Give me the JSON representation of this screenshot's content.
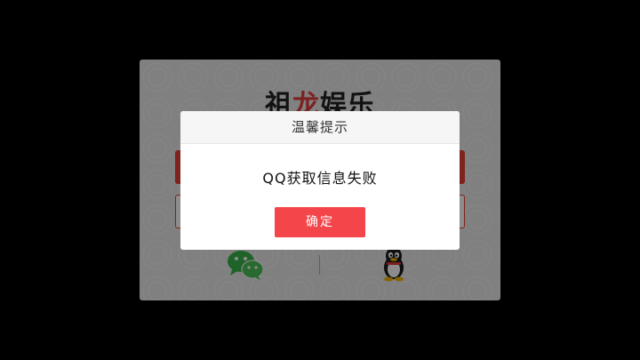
{
  "background_panel": {
    "logo_text_part1": "祖",
    "logo_text_accent": "龙",
    "logo_text_part2": "娱乐"
  },
  "social_login": {
    "wechat_icon": "wechat-icon",
    "qq_icon": "qq-penguin-icon"
  },
  "dialog": {
    "title": "温馨提示",
    "message": "QQ获取信息失败",
    "confirm_label": "确定"
  },
  "colors": {
    "accent": "#f3454a",
    "wechat_green": "#3bb54a"
  }
}
